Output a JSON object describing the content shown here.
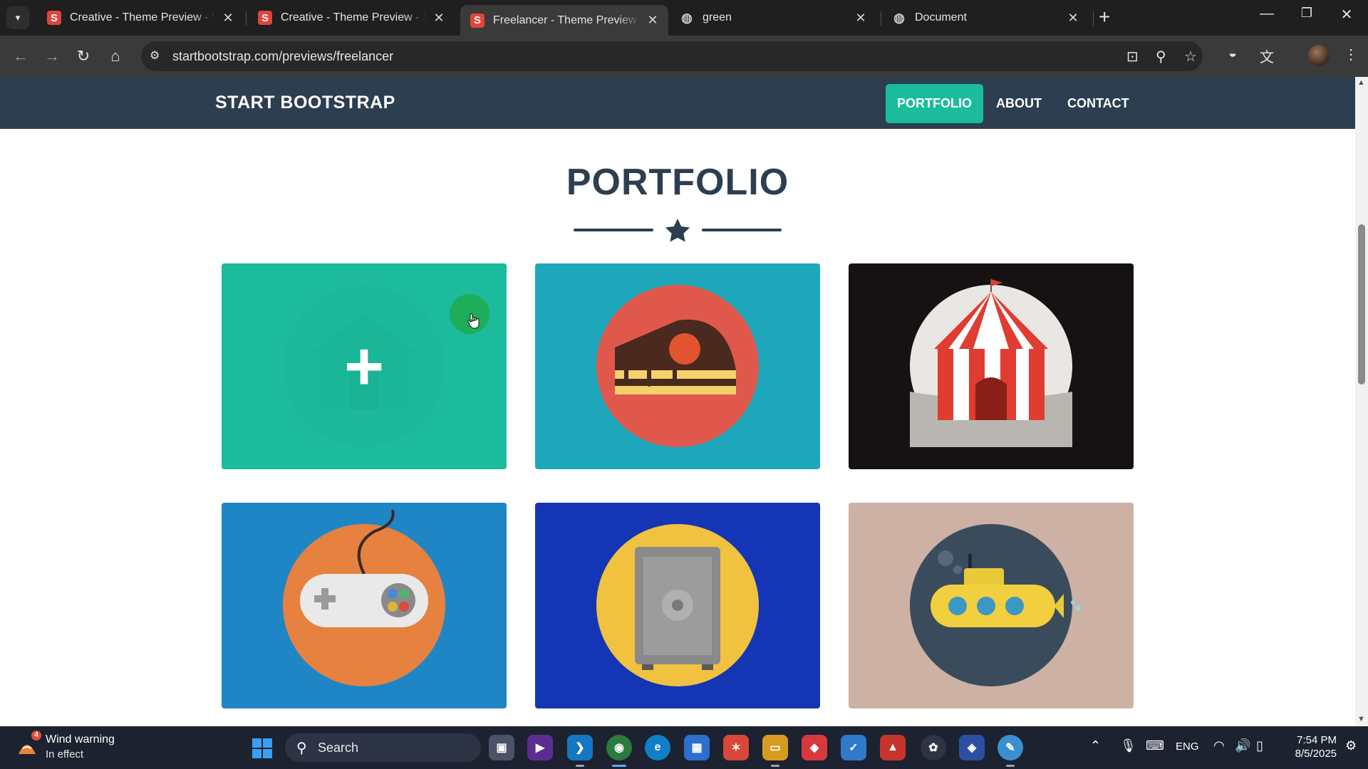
{
  "browser": {
    "tabs": [
      {
        "title": "Creative - Theme Preview - Start Bootstrap",
        "favicon": "S",
        "active": false
      },
      {
        "title": "Creative - Theme Preview - Start Bootstrap",
        "favicon": "S",
        "active": false
      },
      {
        "title": "Freelancer - Theme Preview - Start Bootstrap",
        "favicon": "S",
        "active": true
      },
      {
        "title": "green",
        "favicon": "globe-icon",
        "active": false
      },
      {
        "title": "Document",
        "favicon": "globe-icon",
        "active": false
      }
    ],
    "url": "startbootstrap.com/previews/freelancer"
  },
  "site": {
    "brand": "START BOOTSTRAP",
    "nav": [
      {
        "label": "PORTFOLIO",
        "active": true
      },
      {
        "label": "ABOUT",
        "active": false
      },
      {
        "label": "CONTACT",
        "active": false
      }
    ],
    "section_title": "PORTFOLIO",
    "accent_color": "#1abc9c",
    "nav_color": "#2c3e50",
    "portfolio": [
      {
        "subject": "cabin",
        "background": "#2db39c",
        "hovered": true,
        "overlay_icon": "plus-icon"
      },
      {
        "subject": "cake",
        "background": "#1ea6bb"
      },
      {
        "subject": "circus-tent",
        "background": "#161112"
      },
      {
        "subject": "game-controller",
        "background": "#1f86c6"
      },
      {
        "subject": "safe",
        "background": "#1536b4"
      },
      {
        "subject": "submarine",
        "background": "#cdb1a4"
      }
    ]
  },
  "taskbar": {
    "weather_title": "Wind warning",
    "weather_subtitle": "In effect",
    "weather_badge": "4",
    "search_label": "Search",
    "language": "ENG",
    "time": "7:54 PM",
    "date": "8/5/2025"
  }
}
